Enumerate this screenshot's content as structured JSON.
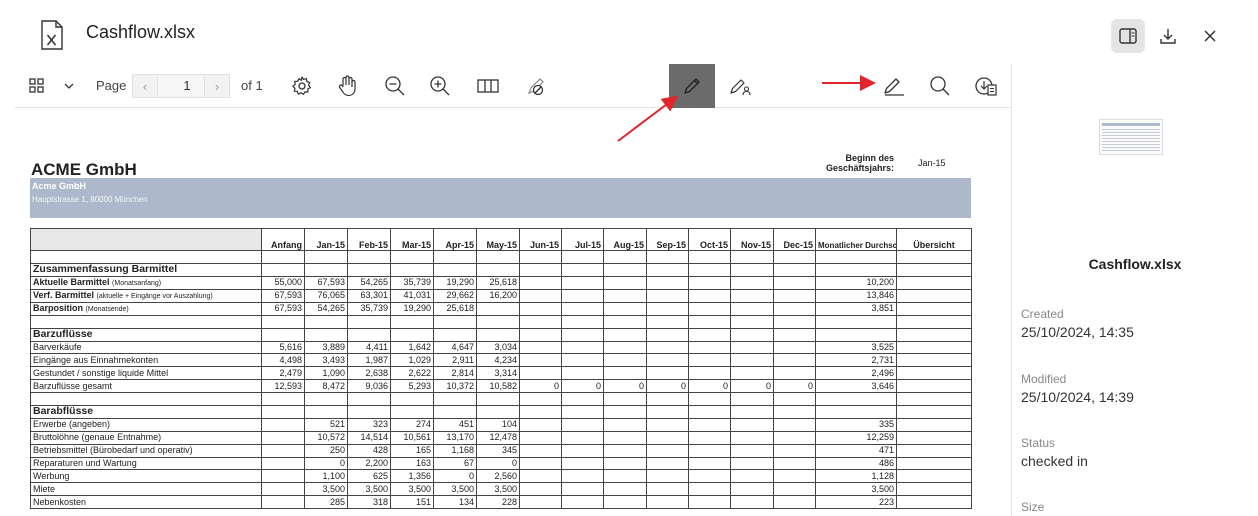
{
  "file_name": "Cashflow.xlsx",
  "icons": {
    "file": "excel-file-icon",
    "panel": "side-panel-icon",
    "download": "download-icon",
    "close": "close-icon"
  },
  "colors": {
    "band": "#adb9ca",
    "arrow": "#e0262c",
    "active_tool": "#6b6b6b"
  },
  "toolbar": {
    "page_label": "Page",
    "prev": "‹",
    "next": "›",
    "page_value": "1",
    "of_label": "of 1"
  },
  "sidebar": {
    "file_name": "Cashflow.xlsx",
    "created_label": "Created",
    "created_value": "25/10/2024, 14:35",
    "modified_label": "Modified",
    "modified_value": "25/10/2024, 14:39",
    "status_label": "Status",
    "status_value": "checked in",
    "size_label": "Size"
  },
  "sheet": {
    "company": "ACME GmbH",
    "begin_label": "Beginn des Geschäftsjahrs:",
    "begin_value": "Jan-15",
    "band_name": "Acme GmbH",
    "band_address": "Hauptstrasse 1, 80000 München",
    "headers": [
      "",
      "Anfang",
      "Jan-15",
      "Feb-15",
      "Mar-15",
      "Apr-15",
      "May-15",
      "Jun-15",
      "Jul-15",
      "Aug-15",
      "Sep-15",
      "Oct-15",
      "Nov-15",
      "Dec-15",
      "Monatlicher Durchschnitt",
      "Übersicht"
    ],
    "rows": [
      {
        "type": "blank"
      },
      {
        "type": "section",
        "label": "Zusammenfassung Barmittel"
      },
      {
        "type": "data",
        "bold": true,
        "label": "Aktuelle Barmittel",
        "note": "(Monatsanfang)",
        "values": [
          "55,000",
          "67,593",
          "54,265",
          "35,739",
          "19,290",
          "25,618",
          "",
          "",
          "",
          "",
          "",
          "",
          ""
        ],
        "avg": "10,200"
      },
      {
        "type": "data",
        "bold": true,
        "label": "Verf. Barmittel",
        "note": "(aktuelle + Eingänge vor Auszahlung)",
        "values": [
          "67,593",
          "76,065",
          "63,301",
          "41,031",
          "29,662",
          "16,200",
          "",
          "",
          "",
          "",
          "",
          "",
          ""
        ],
        "avg": "13,846"
      },
      {
        "type": "data",
        "bold": true,
        "label": "Barposition",
        "note": "(Monatsende)",
        "values": [
          "67,593",
          "54,265",
          "35,739",
          "19,290",
          "25,618",
          "",
          "",
          "",
          "",
          "",
          "",
          "",
          ""
        ],
        "avg": "3,851"
      },
      {
        "type": "blank"
      },
      {
        "type": "section",
        "label": "Barzuflüsse"
      },
      {
        "type": "data",
        "label": "Barverkäufe",
        "values": [
          "5,616",
          "3,889",
          "4,411",
          "1,642",
          "4,647",
          "3,034",
          "",
          "",
          "",
          "",
          "",
          "",
          ""
        ],
        "avg": "3,525"
      },
      {
        "type": "data",
        "label": "Eingänge aus Einnahmekonten",
        "values": [
          "4,498",
          "3,493",
          "1,987",
          "1,029",
          "2,911",
          "4,234",
          "",
          "",
          "",
          "",
          "",
          "",
          ""
        ],
        "avg": "2,731"
      },
      {
        "type": "data",
        "label": "Gestundet / sonstige liquide Mittel",
        "values": [
          "2,479",
          "1,090",
          "2,638",
          "2,622",
          "2,814",
          "3,314",
          "",
          "",
          "",
          "",
          "",
          "",
          ""
        ],
        "avg": "2,496"
      },
      {
        "type": "data",
        "label": "Barzuflüsse gesamt",
        "values": [
          "12,593",
          "8,472",
          "9,036",
          "5,293",
          "10,372",
          "10,582",
          "0",
          "0",
          "0",
          "0",
          "0",
          "0",
          "0"
        ],
        "avg": "3,646"
      },
      {
        "type": "blank"
      },
      {
        "type": "section",
        "label": "Barabflüsse"
      },
      {
        "type": "data",
        "label": "Erwerbe (angeben)",
        "values": [
          "",
          "521",
          "323",
          "274",
          "451",
          "104",
          "",
          "",
          "",
          "",
          "",
          "",
          ""
        ],
        "avg": "335"
      },
      {
        "type": "data",
        "label": "Bruttolöhne (genaue Entnahme)",
        "values": [
          "",
          "10,572",
          "14,514",
          "10,561",
          "13,170",
          "12,478",
          "",
          "",
          "",
          "",
          "",
          "",
          ""
        ],
        "avg": "12,259"
      },
      {
        "type": "data",
        "label": "Betriebsmittel (Bürobedarf und operativ)",
        "values": [
          "",
          "250",
          "428",
          "165",
          "1,168",
          "345",
          "",
          "",
          "",
          "",
          "",
          "",
          ""
        ],
        "avg": "471"
      },
      {
        "type": "data",
        "label": "Reparaturen und Wartung",
        "values": [
          "",
          "0",
          "2,200",
          "163",
          "67",
          "0",
          "",
          "",
          "",
          "",
          "",
          "",
          ""
        ],
        "avg": "486"
      },
      {
        "type": "data",
        "label": "Werbung",
        "values": [
          "",
          "1,100",
          "625",
          "1,356",
          "0",
          "2,560",
          "",
          "",
          "",
          "",
          "",
          "",
          ""
        ],
        "avg": "1,128"
      },
      {
        "type": "data",
        "label": "Miete",
        "values": [
          "",
          "3,500",
          "3,500",
          "3,500",
          "3,500",
          "3,500",
          "",
          "",
          "",
          "",
          "",
          "",
          ""
        ],
        "avg": "3,500"
      },
      {
        "type": "data",
        "label": "Nebenkosten",
        "values": [
          "",
          "285",
          "318",
          "151",
          "134",
          "228",
          "",
          "",
          "",
          "",
          "",
          "",
          ""
        ],
        "avg": "223"
      }
    ]
  }
}
